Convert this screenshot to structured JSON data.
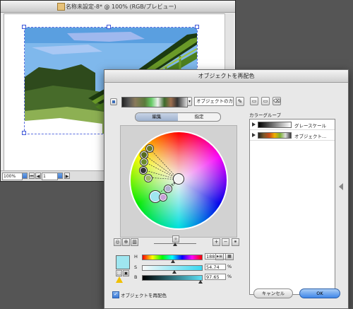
{
  "document": {
    "title": "名称未設定-8* @ 100% (RGB/プレビュー)",
    "zoom": "100%",
    "page": "1"
  },
  "recolor_dialog": {
    "title": "オブジェクトを再配色",
    "current_colors_field": "オブジェクトのカラ",
    "tabs": [
      "編集",
      "指定"
    ],
    "active_tab": "編集",
    "hsb": {
      "h_label": "H",
      "h_value": "188.31",
      "h_unit": "°",
      "s_label": "S",
      "s_value": "54.74",
      "s_unit": "%",
      "b_label": "B",
      "b_value": "97.65",
      "b_unit": "%"
    },
    "selected_color": "#9fe6f0",
    "color_groups_label": "カラーグループ",
    "color_groups": [
      {
        "name": "グレースケール"
      },
      {
        "name": "オブジェクト..."
      }
    ],
    "recolor_checkbox_label": "オブジェクトを再配色",
    "recolor_checked": true,
    "cancel_label": "キャンセル",
    "ok_label": "OK"
  },
  "colors": {
    "accent": "#3d7fe0",
    "ok_button": "#3f86e8"
  }
}
